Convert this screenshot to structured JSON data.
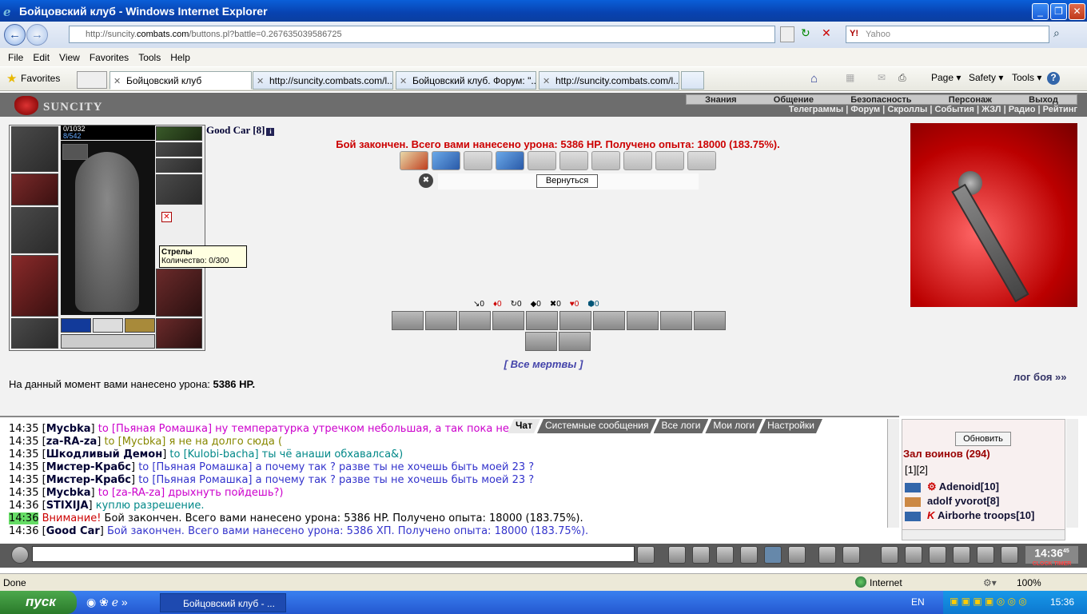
{
  "window": {
    "title": "Бойцовский клуб - Windows Internet Explorer",
    "min": "_",
    "max": "❐",
    "close": "✕"
  },
  "address": {
    "url_prefix": "http://suncity.",
    "url_host": "combats.com",
    "url_rest": "/buttons.pl?battle=0.267635039586725",
    "search_placeholder": "Yahoo",
    "search_brand": "Y!"
  },
  "menu": [
    "File",
    "Edit",
    "View",
    "Favorites",
    "Tools",
    "Help"
  ],
  "favorites": "Favorites",
  "tabs": [
    {
      "label": "Бойцовский клуб"
    },
    {
      "label": "http://suncity.combats.com/l..."
    },
    {
      "label": "Бойцовский клуб. Форум: \"..."
    },
    {
      "label": "http://suncity.combats.com/l..."
    }
  ],
  "toolbar": {
    "page": "Page ▾",
    "safety": "Safety ▾",
    "tools": "Tools ▾",
    "help": "?"
  },
  "game": {
    "logo": "SUNCITY",
    "topmenu": [
      "Знания",
      "Общение",
      "Безопасность",
      "Персонаж",
      "Выход"
    ],
    "submenu": "Телеграммы | Форум | Скроллы | События | ЖЗЛ | Радио | Рейтинг",
    "hp": "0/1032",
    "mp": "8/542",
    "char_name": "Good Car [8]",
    "info": "i",
    "tooltip_title": "Стрелы",
    "tooltip_text": "Количество: 0/300",
    "battle_message": "Бой закончен. Всего вами нанесено урона: 5386 HP. Получено опыта: 18000 (183.75%).",
    "back_button": "Вернуться",
    "stats": [
      "↘0",
      "♦0",
      "↻0",
      "◆0",
      "✖0",
      "♥0",
      "⬢0"
    ],
    "all_dead": "[ Все мертвы ]",
    "damage_label": "На данный момент вами нанесено урона: ",
    "damage_value": "5386 HP.",
    "battle_log": "лог боя »»"
  },
  "chat": {
    "tabs": [
      "Чат",
      "Системные сообщения",
      "Все логи",
      "Мои логи",
      "Настройки"
    ],
    "lines": [
      {
        "time": "14:35",
        "name": "Mycbka",
        "to": "to [Пьяная Ромашка]",
        "text": " ну температурка утречком небольшая, а так пока не ...((("
      },
      {
        "time": "14:35",
        "name": "za-RA-za",
        "to": "to [Mycbka]",
        "text": " я не на долго сюда ("
      },
      {
        "time": "14:35",
        "name": "Шкодливый Демон",
        "to": "to [Kulobi-bacha]",
        "text": " ты чё анаши обхавалса&)"
      },
      {
        "time": "14:35",
        "name": "Мистер-Крабс",
        "to": "to [Пьяная Ромашка]",
        "text": " а почему так ? разве ты не хочешь быть моей 23 ?"
      },
      {
        "time": "14:35",
        "name": "Мистер-Крабс",
        "to": "to [Пьяная Ромашка]",
        "text": " а почему так ? разве ты не хочешь быть моей 23 ?"
      },
      {
        "time": "14:35",
        "name": "Mycbka",
        "to": "to [za-RA-za]",
        "text": " дрыхнуть пойдешь?)"
      },
      {
        "time": "14:36",
        "name": "STIXIJA",
        "to": "",
        "text": " куплю разрешение."
      }
    ],
    "system_time": "14:36",
    "system_warn": "Внимание!",
    "system_text": " Бой закончен. Всего вами нанесено урона: 5386 HP. Получено опыта: 18000 (183.75%).",
    "last_time": "14:36",
    "last_name": "Good Car",
    "last_text": " Бой закончен. Всего вами нанесено урона: 5386 ХП. Получено опыта: 18000 (183.75%)."
  },
  "side": {
    "refresh": "Обновить",
    "hall_title": "Зал воинов (294)",
    "pages": "[1][2]",
    "players": [
      {
        "name": "Adenoid[10]"
      },
      {
        "name": "adolf yvorot[8]"
      },
      {
        "name": "Airborhe troops[10]"
      }
    ]
  },
  "clock": {
    "time": "14:36",
    "sec": "45",
    "label": "CLOCK TIMER"
  },
  "status": {
    "left": "Done",
    "zone": "Internet",
    "zoom": "100%"
  },
  "taskbar": {
    "start": "пуск",
    "item": "Бойцовский клуб - ...",
    "lang": "EN",
    "time": "15:36"
  }
}
